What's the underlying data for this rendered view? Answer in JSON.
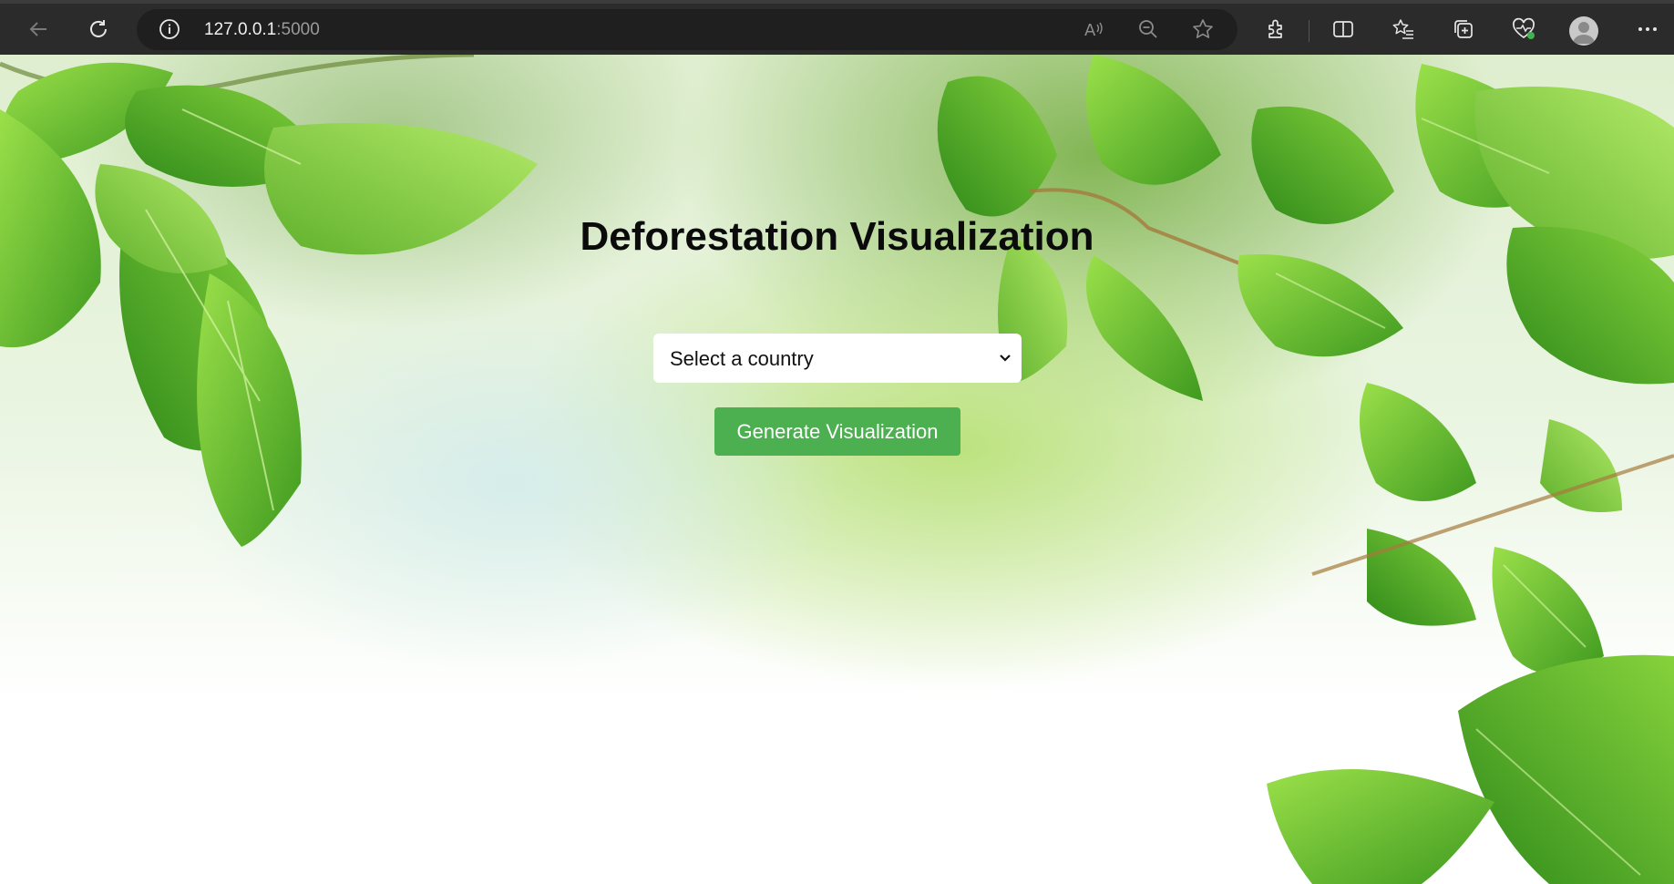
{
  "browser": {
    "url_host": "127.0.0.1",
    "url_port": ":5000",
    "icons": [
      "back-icon",
      "refresh-icon",
      "site-info-icon",
      "read-aloud-icon",
      "zoom-out-icon",
      "favorite-star-icon",
      "extensions-icon",
      "split-screen-icon",
      "favorites-list-icon",
      "collections-icon",
      "browser-essentials-icon",
      "profile-avatar-icon",
      "more-menu-icon"
    ]
  },
  "page": {
    "title": "Deforestation Visualization",
    "country_select": {
      "selected": "Select a country"
    },
    "generate_button_label": "Generate Visualization",
    "colors": {
      "button_bg": "#4caf50",
      "button_text": "#ffffff",
      "title_text": "#0b0b0b"
    }
  }
}
